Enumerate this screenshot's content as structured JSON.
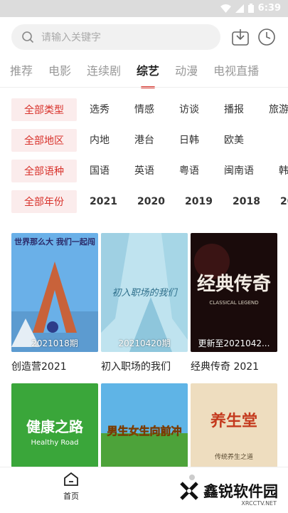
{
  "status": {
    "time": "6:39"
  },
  "search": {
    "placeholder": "请输入关键字"
  },
  "tabs": [
    "推荐",
    "电影",
    "连续剧",
    "综艺",
    "动漫",
    "电视直播"
  ],
  "active_tab": "综艺",
  "filters": [
    {
      "key": "全部类型",
      "options": [
        "选秀",
        "情感",
        "访谈",
        "播报",
        "旅游"
      ]
    },
    {
      "key": "全部地区",
      "options": [
        "内地",
        "港台",
        "日韩",
        "欧美"
      ]
    },
    {
      "key": "全部语种",
      "options": [
        "国语",
        "英语",
        "粤语",
        "闽南语",
        "韩"
      ]
    },
    {
      "key": "全部年份",
      "options": [
        "2021",
        "2020",
        "2019",
        "2018",
        "20"
      ]
    }
  ],
  "cards": [
    {
      "title": "创造营2021",
      "episode": "2021018期",
      "poster_text": "世界那么大 我们一起闯"
    },
    {
      "title": "初入职场的我们",
      "episode": "20210420期",
      "poster_text": "初入职场的我们"
    },
    {
      "title": "经典传奇 2021",
      "episode": "更新至2021042...",
      "poster_text": "经典传奇",
      "poster_sub": "CLASSICAL LEGEND"
    },
    {
      "title": "",
      "episode": "",
      "poster_text": "健康之路",
      "poster_sub": "Healthy Road"
    },
    {
      "title": "",
      "episode": "",
      "poster_text": "男生女生向前冲"
    },
    {
      "title": "",
      "episode": "",
      "poster_text": "养生堂",
      "poster_sub": "传统养生之道"
    }
  ],
  "bottom_nav": {
    "home_label": "首页"
  },
  "watermark": {
    "text": "鑫锐软件园",
    "sub": "XRCCTV.NET"
  },
  "colors": {
    "accent": "#d8322b",
    "filter_bg": "#fbecec"
  }
}
